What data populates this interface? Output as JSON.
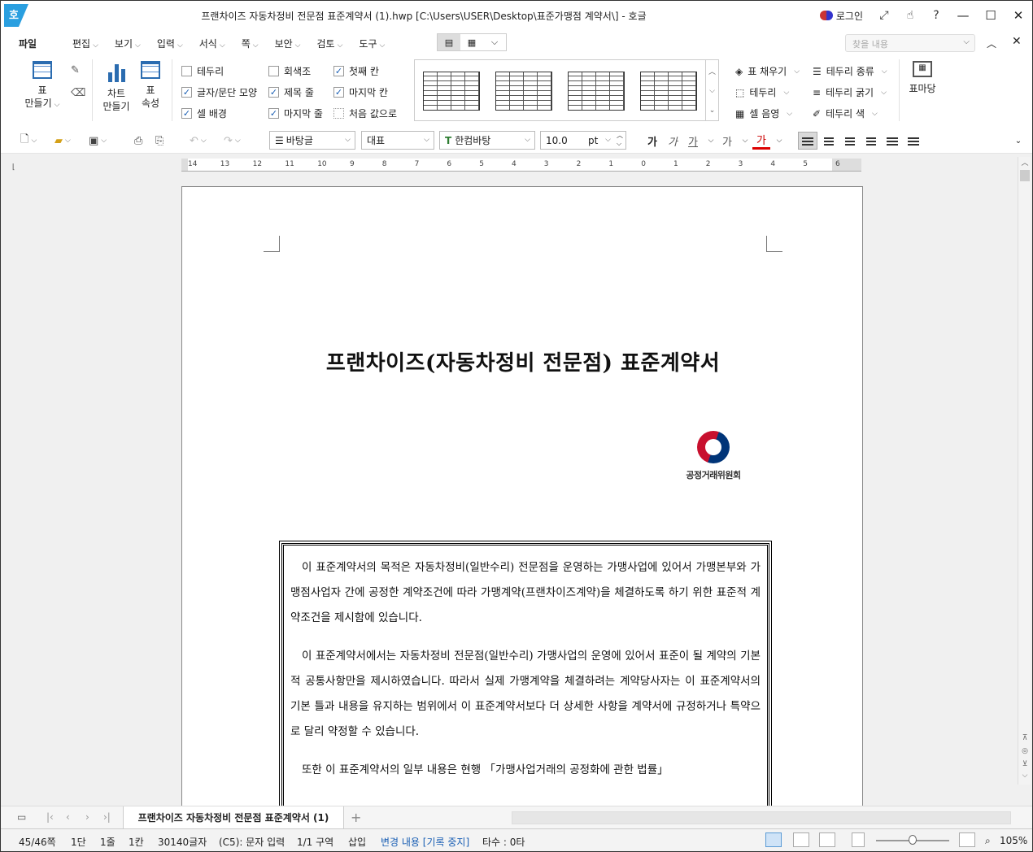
{
  "titlebar": {
    "app_glyph": "호",
    "title": "프랜차이즈 자동차정비 전문점 표준계약서 (1).hwp [C:\\Users\\USER\\Desktop\\표준가맹점 계약서\\] - 호글",
    "login": "로그인",
    "icons": [
      "expand-icon",
      "hand-icon",
      "help-icon"
    ],
    "help": "?",
    "minimize": "—",
    "maximize": "☐",
    "close": "✕"
  },
  "menubar": {
    "file": "파일",
    "items": [
      "편집",
      "보기",
      "입력",
      "서식",
      "쪽",
      "보안",
      "검토",
      "도구"
    ],
    "search_placeholder": "찾을 내용"
  },
  "ribbon": {
    "table_make": "표\n만들기",
    "table_make_l1": "표",
    "table_make_l2": "만들기",
    "chart_l1": "차트",
    "chart_l2": "만들기",
    "props_l1": "표",
    "props_l2": "속성",
    "checks": [
      {
        "label": "테두리",
        "checked": false
      },
      {
        "label": "글자/문단 모양",
        "checked": true
      },
      {
        "label": "셀 배경",
        "checked": true
      },
      {
        "label": "회색조",
        "checked": false
      },
      {
        "label": "제목 줄",
        "checked": true
      },
      {
        "label": "마지막 줄",
        "checked": true
      },
      {
        "label": "첫째 칸",
        "checked": true
      },
      {
        "label": "마지막 칸",
        "checked": true
      },
      {
        "label": "처음 값으로",
        "checked": false
      }
    ],
    "right_items": [
      "표 채우기",
      "테두리",
      "셀 음영",
      "테두리 종류",
      "테두리 굵기",
      "테두리 색"
    ],
    "table_margin": "표마당"
  },
  "toolbar": {
    "style": "바탕글",
    "lang": "대표",
    "font": "한컴바탕",
    "size": "10.0",
    "unit": "pt",
    "font_btns": [
      "가",
      "가",
      "가",
      "가",
      "가"
    ]
  },
  "ruler": {
    "ticks": [
      "14",
      "13",
      "12",
      "11",
      "10",
      "9",
      "8",
      "7",
      "6",
      "5",
      "4",
      "3",
      "2",
      "1",
      "0",
      "1",
      "2",
      "3",
      "4",
      "5",
      "6"
    ]
  },
  "document": {
    "heading": "프랜차이즈(자동차정비 전문점) 표준계약서",
    "logo_text": "공정거래위원회",
    "paragraphs": [
      "이 표준계약서의 목적은 자동차정비(일반수리) 전문점을 운영하는 가맹사업에 있어서 가맹본부와 가맹점사업자 간에 공정한 계약조건에 따라 가맹계약(프랜차이즈계약)을 체결하도록 하기 위한 표준적 계약조건을 제시함에 있습니다.",
      "이 표준계약서에서는 자동차정비 전문점(일반수리) 가맹사업의 운영에 있어서 표준이 될 계약의 기본적 공통사항만을 제시하였습니다. 따라서 실제 가맹계약을 체결하려는 계약당사자는 이 표준계약서의 기본 틀과 내용을 유지하는 범위에서 이 표준계약서보다 더 상세한 사항을 계약서에 규정하거나 특약으로 달리 약정할 수 있습니다.",
      "또한 이 표준계약서의 일부 내용은 현행 「가맹사업거래의 공정화에 관한 법률」"
    ]
  },
  "tabbar": {
    "tab_title": "프랜차이즈 자동차정비 전문점 표준계약서 (1)",
    "add": "+"
  },
  "status": {
    "page": "45/46쪽",
    "section": "1단",
    "line": "1줄",
    "column": "1칸",
    "chars": "30140글자",
    "mode": "(C5): 문자 입력",
    "area": "1/1 구역",
    "insert": "삽입",
    "track": "변경 내용 [기록 중지]",
    "typing": "타수 : 0타",
    "zoom": "105%"
  },
  "colors": {
    "accent": "#1a5fb4",
    "logo_red": "#c8102e",
    "logo_blue": "#003478"
  }
}
